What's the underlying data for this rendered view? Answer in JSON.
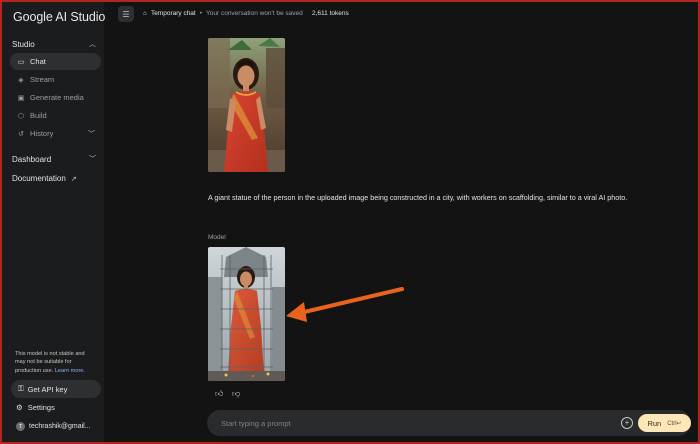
{
  "app": {
    "title": "Google AI Studio"
  },
  "sidebar": {
    "studio_label": "Studio",
    "items": [
      {
        "label": "Chat",
        "icon": "chat-icon",
        "active": true
      },
      {
        "label": "Stream",
        "icon": "stream-icon"
      },
      {
        "label": "Generate media",
        "icon": "media-icon"
      },
      {
        "label": "Build",
        "icon": "build-icon"
      },
      {
        "label": "History",
        "icon": "history-icon"
      }
    ],
    "dashboard_label": "Dashboard",
    "documentation_label": "Documentation",
    "warning": {
      "text": "This model is not stable and may not be suitable for production use.",
      "link": "Learn more."
    },
    "api_key_label": "Get API key",
    "settings_label": "Settings",
    "user": {
      "initial": "T",
      "email": "techrashik@gmail..."
    }
  },
  "header": {
    "chat_type": "Temporary chat",
    "separator": "•",
    "notice": "Your conversation won't be saved",
    "tokens": "2,611 tokens"
  },
  "conversation": {
    "user_prompt": "A giant statue of the person in the uploaded image being constructed in a city, with workers on scaffolding, similar to a viral AI photo.",
    "model_label": "Model"
  },
  "prompt_bar": {
    "placeholder": "Start typing a prompt",
    "run_label": "Run",
    "run_shortcut": "Ctrl↵"
  },
  "colors": {
    "background": "#131313",
    "sidebar": "#1b1c1d",
    "run_button": "#fde6b8",
    "annotation_arrow": "#e8641e",
    "frame": "#b3261e"
  }
}
